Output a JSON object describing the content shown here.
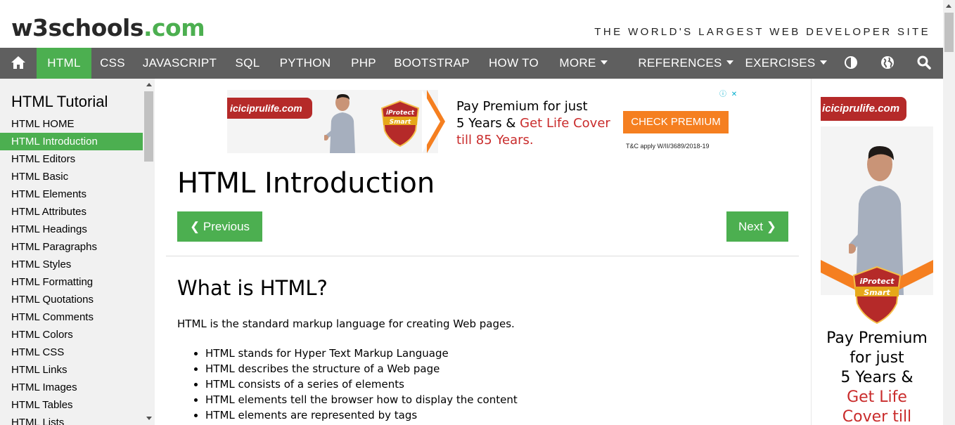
{
  "logo": {
    "w3": "w3schools",
    "com": ".com"
  },
  "tagline": "THE WORLD'S LARGEST WEB DEVELOPER SITE",
  "topnav": {
    "home_icon": "home-icon",
    "items": [
      "HTML",
      "CSS",
      "JAVASCRIPT",
      "SQL",
      "PYTHON",
      "PHP",
      "BOOTSTRAP",
      "HOW TO",
      "MORE",
      "REFERENCES",
      "EXERCISES"
    ],
    "active": "HTML",
    "icons": [
      "contrast-icon",
      "globe-icon",
      "search-icon"
    ]
  },
  "sidebar": {
    "title": "HTML Tutorial",
    "items": [
      "HTML HOME",
      "HTML Introduction",
      "HTML Editors",
      "HTML Basic",
      "HTML Elements",
      "HTML Attributes",
      "HTML Headings",
      "HTML Paragraphs",
      "HTML Styles",
      "HTML Formatting",
      "HTML Quotations",
      "HTML Comments",
      "HTML Colors",
      "HTML CSS",
      "HTML Links",
      "HTML Images",
      "HTML Tables",
      "HTML Lists"
    ],
    "active": "HTML Introduction"
  },
  "ad_top": {
    "brand": "iciciprulife.com",
    "line1": "Pay Premium for just",
    "line2_black": "5 Years & ",
    "line2_red": "Get Life Cover",
    "line3": "till 85 Years.",
    "cta": "CHECK PREMIUM",
    "tc": "T&C apply W/II/3689/2018-19"
  },
  "main": {
    "title": "HTML Introduction",
    "prev": "❮ Previous",
    "next": "Next ❯",
    "h2": "What is HTML?",
    "para": "HTML is the standard markup language for creating Web pages.",
    "bullets": [
      "HTML stands for Hyper Text Markup Language",
      "HTML describes the structure of a Web page",
      "HTML consists of a series of elements",
      "HTML elements tell the browser how to display the content",
      "HTML elements are represented by tags"
    ]
  },
  "ad_right": {
    "brand": "iciciprulife.com",
    "line1": "Pay Premium",
    "line2": "for just",
    "line3": "5 Years &",
    "line4": "Get Life",
    "line5": "Cover till"
  },
  "colors": {
    "accent": "#4CAF50",
    "nav": "#5f5f5f",
    "ad_red": "#c92b2b",
    "ad_orange": "#f57f20"
  }
}
